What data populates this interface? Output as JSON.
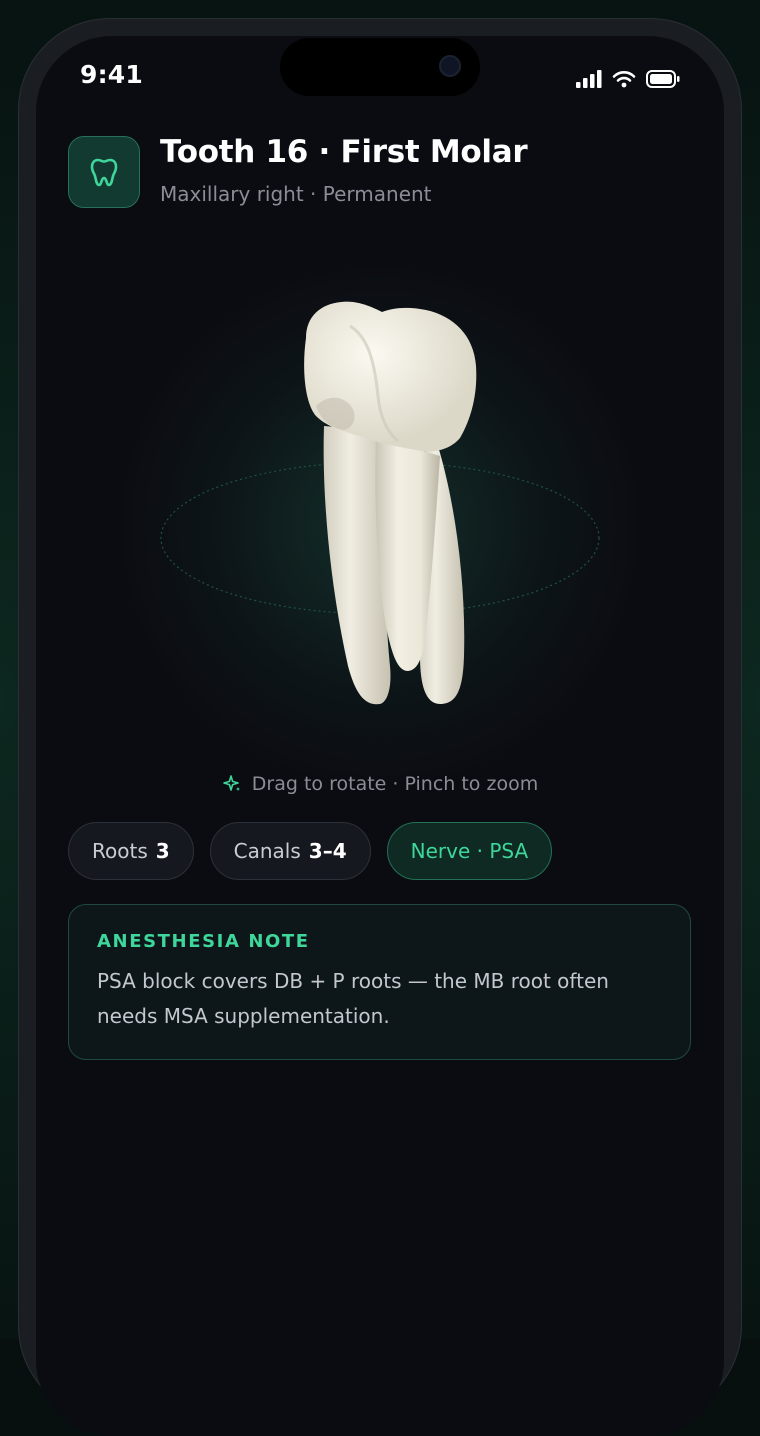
{
  "status_bar": {
    "time": "9:41"
  },
  "header": {
    "icon": "tooth-icon",
    "title": "Tooth 16 · First Molar",
    "subtitle": "Maxillary right · Permanent"
  },
  "viewer": {
    "hint": "Drag to rotate · Pinch to zoom",
    "hint_icon": "sparkle-icon"
  },
  "chips": [
    {
      "label": "Roots",
      "value": "3"
    },
    {
      "label": "Canals",
      "value": "3–4"
    },
    {
      "label": "Nerve · PSA"
    }
  ],
  "note": {
    "label": "ANESTHESIA NOTE",
    "body": "PSA block covers DB + P roots — the MB root often needs MSA supplementation."
  },
  "colors": {
    "accent": "#3fd69b",
    "background": "#0b0c12",
    "card": "#0d1619"
  }
}
